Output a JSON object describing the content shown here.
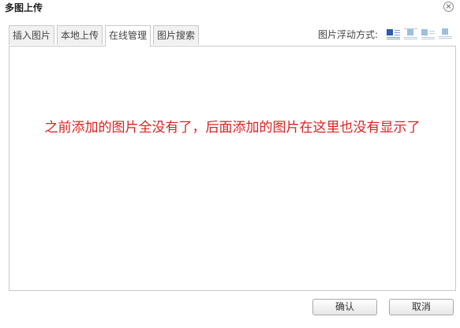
{
  "dialog": {
    "title": "多图上传",
    "close_glyph": "×"
  },
  "tabs": [
    {
      "label": "插入图片",
      "active": false
    },
    {
      "label": "本地上传",
      "active": false
    },
    {
      "label": "在线管理",
      "active": true
    },
    {
      "label": "图片搜索",
      "active": false
    }
  ],
  "float_options": {
    "label": "图片浮动方式:",
    "icons": [
      "float-none-icon",
      "float-left-icon",
      "float-right-icon",
      "float-center-icon"
    ]
  },
  "panel": {
    "message": "之前添加的图片全没有了，后面添加的图片在这里也没有显示了",
    "message_color": "#e02020"
  },
  "buttons": {
    "confirm": "确认",
    "cancel": "取消"
  }
}
